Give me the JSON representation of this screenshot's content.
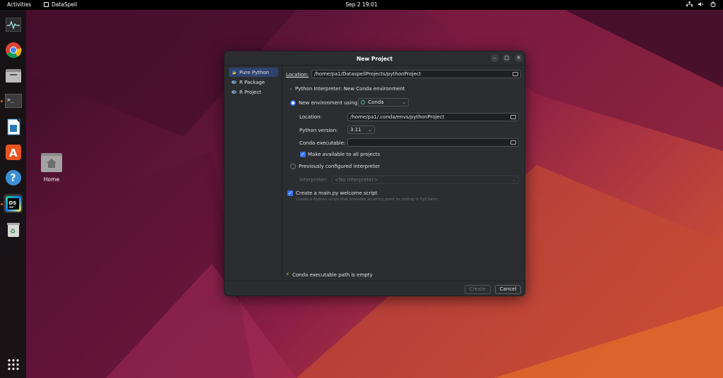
{
  "topbar": {
    "activities": "Activities",
    "app_name": "DataSpell",
    "clock": "Sep 2  19:01",
    "tray_icons": [
      "network-icon",
      "volume-icon",
      "power-icon"
    ]
  },
  "dock": {
    "items": [
      {
        "name": "system-monitor-icon"
      },
      {
        "name": "chrome-icon"
      },
      {
        "name": "files-icon"
      },
      {
        "name": "terminal-icon"
      },
      {
        "name": "libreoffice-writer-icon"
      },
      {
        "name": "software-center-icon"
      },
      {
        "name": "help-icon"
      },
      {
        "name": "dataspell-icon",
        "label": "DS"
      },
      {
        "name": "trash-icon"
      },
      {
        "name": "app-grid-icon"
      }
    ]
  },
  "desktop": {
    "home_label": "Home"
  },
  "dialog": {
    "title": "New Project",
    "sidebar": [
      {
        "label": "Pure Python"
      },
      {
        "label": "R Package"
      },
      {
        "label": "R Project"
      }
    ],
    "location_label": "Location:",
    "location_value": "/home/pa1/DataspellProjects/pythonProject",
    "interpreter_section": "Python Interpreter: New Conda environment",
    "new_env_label": "New environment using",
    "env_tool": "Conda",
    "env_location_label": "Location:",
    "env_location_value": "/home/pa1/.conda/envs/pythonProject",
    "python_version_label": "Python version:",
    "python_version": "3.11",
    "conda_exec_label": "Conda executable:",
    "conda_exec_value": "",
    "make_available_label": "Make available to all projects",
    "previously_configured_label": "Previously configured interpreter",
    "interpreter_label": "Interpreter:",
    "interpreter_value": "<No interpreter>",
    "create_main_label": "Create a main.py welcome script",
    "create_main_hint": "Create a Python script that provides an entry point to coding in PyCharm.",
    "warning": "Conda executable path is empty",
    "create_button": "Create",
    "cancel_button": "Cancel"
  },
  "colors": {
    "accent": "#3574f0",
    "dialog_bg": "#2b2d30",
    "topbar_bg": "#000000",
    "ubuntu_orange": "#e95420"
  }
}
